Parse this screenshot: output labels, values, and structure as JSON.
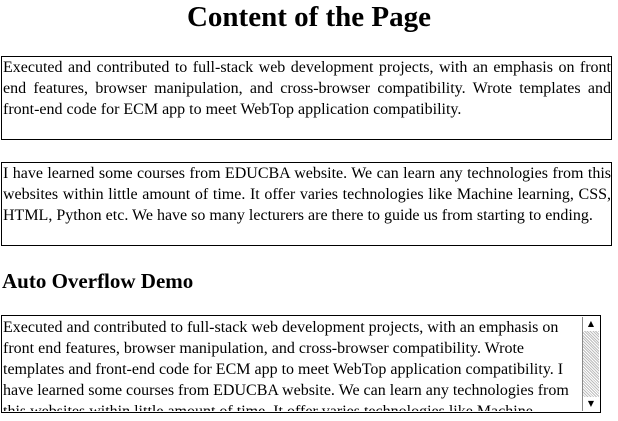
{
  "page_title": "Content of the Page",
  "box1": {
    "text": "Executed and contributed to full-stack web development projects, with an emphasis on front end features, browser manipulation, and cross-browser compatibility. Wrote templates and front-end code for ECM app to meet WebTop application compatibility."
  },
  "box2": {
    "text": "I have learned some courses from EDUCBA website. We can learn any technologies from this websites within little amount of time. It offer varies technologies like Machine learning, CSS, HTML, Python etc. We have so many lecturers are there to guide us from starting to ending."
  },
  "section": {
    "heading": "Auto Overflow Demo"
  },
  "overflow_box": {
    "text": "Executed and contributed to full-stack web development projects, with an emphasis on front end features, browser manipulation, and cross-browser compatibility. Wrote templates and front-end code for ECM app to meet WebTop application compatibility. I have learned some courses from EDUCBA website. We can learn any technologies from this websites within little amount of time. It offer varies technologies like Machine learning, CSS, HTML, Python etc. We have so many lecturers are there to guide us from starting to ending.",
    "scroll_up_icon": "▲",
    "scroll_down_icon": "▼"
  }
}
